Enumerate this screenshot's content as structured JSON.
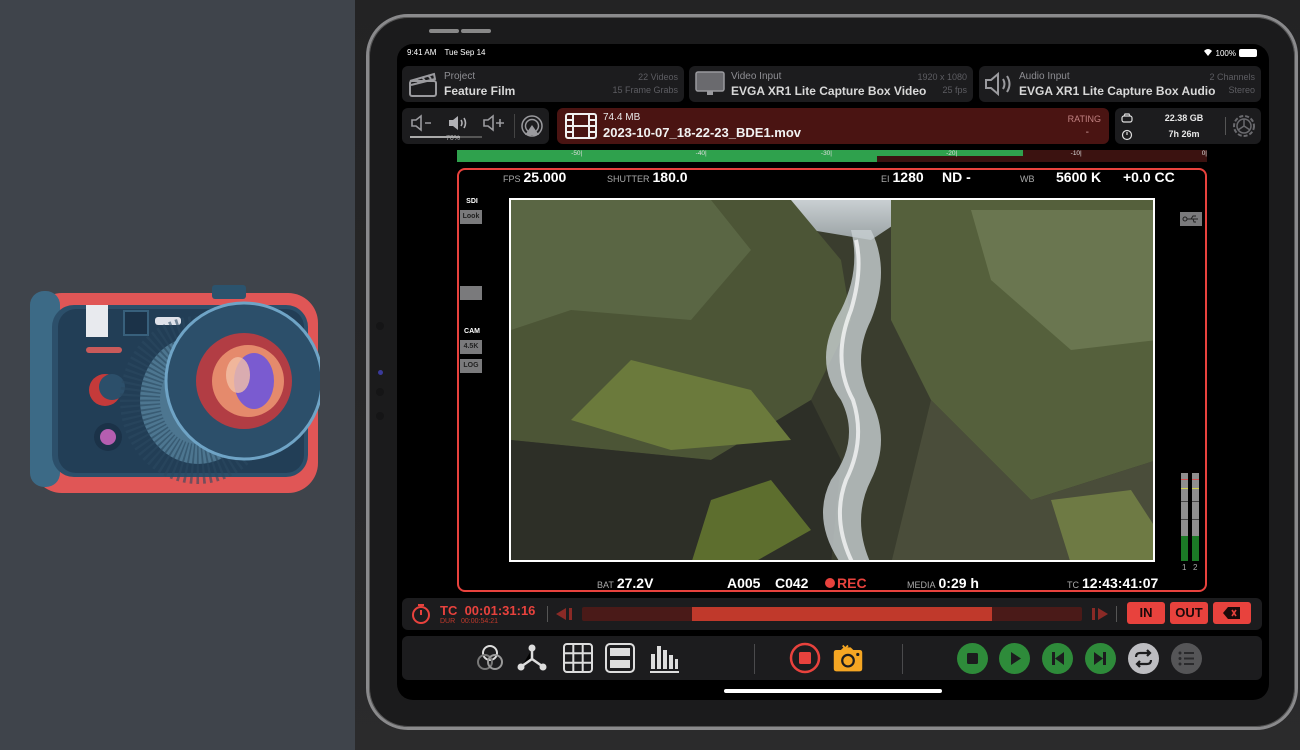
{
  "status_bar": {
    "time": "9:41 AM",
    "date": "Tue Sep 14",
    "battery": "100%"
  },
  "project": {
    "label": "Project",
    "name": "Feature Film",
    "videos": "22 Videos",
    "frame_grabs": "15 Frame Grabs"
  },
  "video_input": {
    "label": "Video Input",
    "device": "EVGA XR1 Lite Capture Box Video",
    "resolution": "1920 x 1080",
    "fps": "25 fps"
  },
  "audio_input": {
    "label": "Audio Input",
    "device": "EVGA XR1 Lite Capture Box Audio",
    "channels": "2 Channels",
    "mode": "Stereo"
  },
  "volume": {
    "level_label": "70%",
    "level": 0.7
  },
  "clip": {
    "size": "74.4 MB",
    "filename": "2023-10-07_18-22-23_BDE1.mov",
    "rating_label": "RATING",
    "rating": "-"
  },
  "storage": {
    "free": "22.38 GB",
    "time_left": "7h 26m"
  },
  "level_meter": {
    "ticks": [
      "-50|",
      "-40|",
      "-30|",
      "-20|",
      "-10|",
      "0|"
    ],
    "top_level": 0.755,
    "bottom_level": 0.56
  },
  "camera": {
    "fps_label": "FPS",
    "fps": "25.000",
    "shutter_label": "SHUTTER",
    "shutter": "180.0",
    "ei_label": "EI",
    "ei": "1280",
    "nd": "ND -",
    "wb_label": "WB",
    "wb": "5600 K",
    "cc": "+0.0 CC",
    "bat_label": "BAT",
    "bat": "27.2V",
    "reel": "A005",
    "clip": "C042",
    "rec": "REC",
    "media_label": "MEDIA",
    "media": "0:29 h",
    "tc_label": "TC",
    "tc": "12:43:41:07"
  },
  "side_left": {
    "sdi": "SDI",
    "look": "Look",
    "cam": "CAM",
    "res": "4.5K",
    "log": "LOG"
  },
  "audio_meters": {
    "labels": [
      "1",
      "2"
    ],
    "levels": [
      0.28,
      0.28
    ]
  },
  "transport": {
    "tc_label": "TC",
    "tc": "00:01:31:16",
    "dur_label": "DUR",
    "dur": "00:00:54:21",
    "scrub_start": 0.22,
    "scrub_end": 0.82,
    "in_label": "IN",
    "out_label": "OUT"
  },
  "colors": {
    "accent_red": "#e8423d",
    "green": "#2e8b3a",
    "orange": "#f5a623"
  }
}
